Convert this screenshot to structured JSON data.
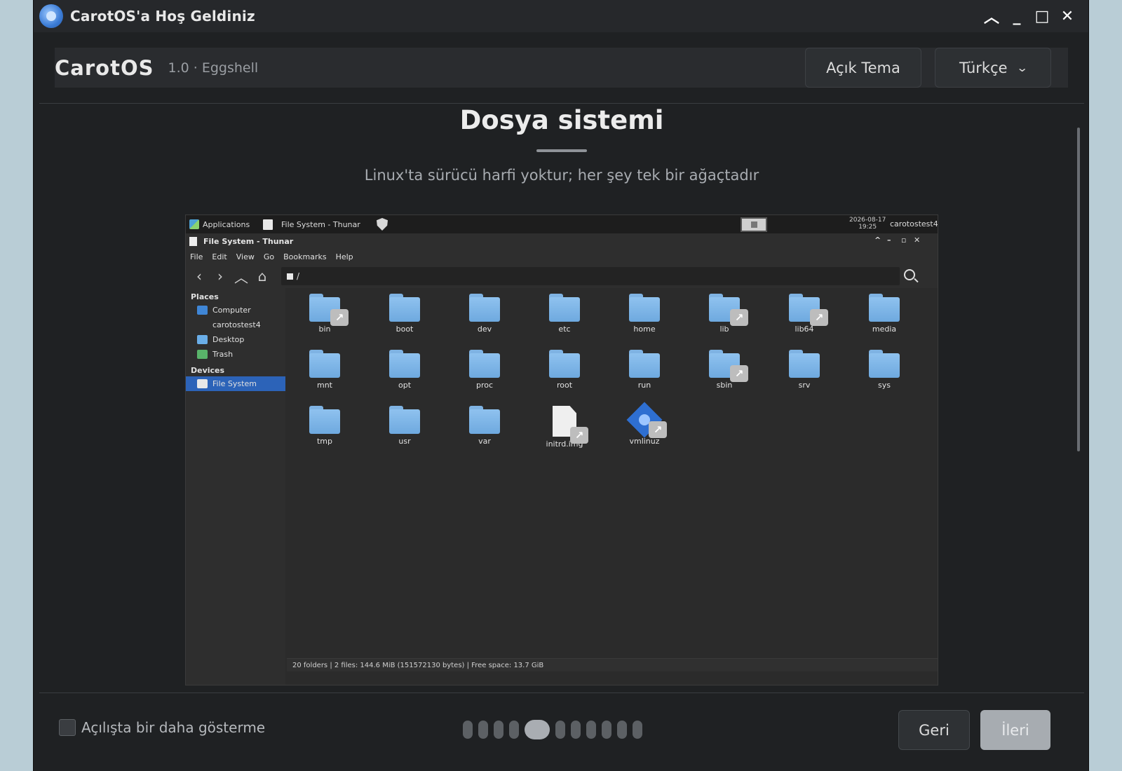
{
  "window": {
    "title": "CarotOS'a Hoş Geldiniz"
  },
  "header": {
    "brand": "CarotOS",
    "version": "1.0 · Eggshell",
    "theme_button": "Açık Tema",
    "language_select": "Türkçe"
  },
  "content": {
    "title": "Dosya sistemi",
    "subtitle": "Linux'ta sürücü harfi yoktur; her şey tek bir ağaçtadır"
  },
  "screenshot": {
    "panel": {
      "applications": "Applications",
      "task": "File System - Thunar",
      "clock_date": "2026-08-17",
      "clock_time": "19:25",
      "user": "carotostest4"
    },
    "window_title": "File System - Thunar",
    "menu": [
      "File",
      "Edit",
      "View",
      "Go",
      "Bookmarks",
      "Help"
    ],
    "path": "/",
    "sidebar": {
      "places_header": "Places",
      "places": [
        "Computer",
        "carotostest4",
        "Desktop",
        "Trash"
      ],
      "devices_header": "Devices",
      "devices": [
        "File System"
      ]
    },
    "files": [
      {
        "name": "bin",
        "type": "folder-link"
      },
      {
        "name": "boot",
        "type": "folder"
      },
      {
        "name": "dev",
        "type": "folder"
      },
      {
        "name": "etc",
        "type": "folder"
      },
      {
        "name": "home",
        "type": "folder"
      },
      {
        "name": "lib",
        "type": "folder-link"
      },
      {
        "name": "lib64",
        "type": "folder-link"
      },
      {
        "name": "media",
        "type": "folder"
      },
      {
        "name": "mnt",
        "type": "folder"
      },
      {
        "name": "opt",
        "type": "folder"
      },
      {
        "name": "proc",
        "type": "folder"
      },
      {
        "name": "root",
        "type": "folder"
      },
      {
        "name": "run",
        "type": "folder"
      },
      {
        "name": "sbin",
        "type": "folder-link"
      },
      {
        "name": "srv",
        "type": "folder"
      },
      {
        "name": "sys",
        "type": "folder"
      },
      {
        "name": "tmp",
        "type": "folder"
      },
      {
        "name": "usr",
        "type": "folder"
      },
      {
        "name": "var",
        "type": "folder"
      },
      {
        "name": "initrd.img",
        "type": "file-link"
      },
      {
        "name": "vmlinuz",
        "type": "exec-link"
      }
    ],
    "status": "20 folders  |  2 files: 144.6 MiB (151572130 bytes)  |  Free space: 13.7 GiB"
  },
  "footer": {
    "dont_show_label": "Açılışta bir daha gösterme",
    "dont_show_checked": false,
    "pages_total": 11,
    "current_page": 5,
    "back_button": "Geri",
    "next_button": "İleri"
  }
}
